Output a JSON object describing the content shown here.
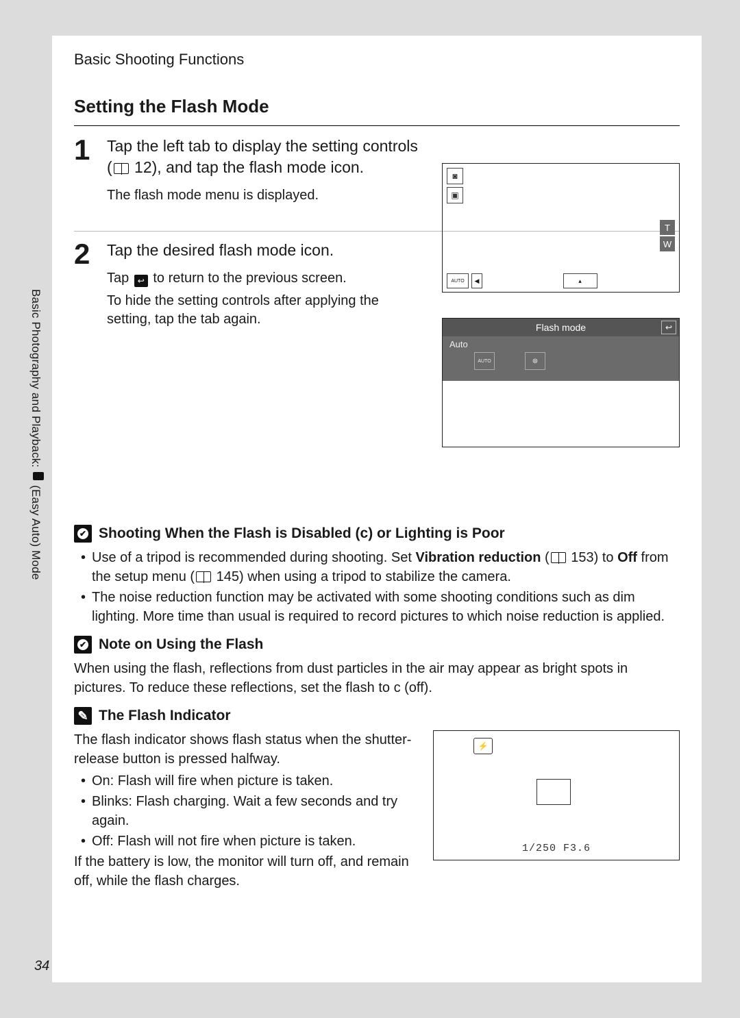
{
  "breadcrumb": "Basic Shooting Functions",
  "side_label_a": "Basic Photography and Playback: ",
  "side_label_b": " (Easy Auto) Mode",
  "page_number": "34",
  "heading": "Setting the Flash Mode",
  "step1": {
    "num": "1",
    "title_a": "Tap the left tab to display the setting controls (",
    "title_ref": " 12), and tap the flash mode icon.",
    "note": "The flash mode menu is displayed."
  },
  "step2": {
    "num": "2",
    "title": "Tap the desired flash mode icon.",
    "note_a": "Tap ",
    "note_b": " to return to the previous screen.",
    "note2": "To hide the setting controls after applying the setting, tap the tab again."
  },
  "screen1": {
    "zoom_t": "T",
    "zoom_w": "W",
    "auto_chip": "AUTO"
  },
  "screen2": {
    "title": "Flash mode",
    "selected_label": "Auto",
    "opt1": "AUTO",
    "opt2": "⊛"
  },
  "notes": {
    "n1_title": "Shooting When the Flash is Disabled (",
    "n1_title_b": ") or Lighting is Poor",
    "n1_off_sym": "c",
    "n1_b1_a": "Use of a tripod is recommended during shooting. Set ",
    "n1_b1_bold": "Vibration reduction",
    "n1_b1_b": " (",
    "n1_b1_ref": " 153) to ",
    "n1_b1_bold2": "Off",
    "n1_b1_c": " from the setup menu (",
    "n1_b1_ref2": " 145) when using a tripod to stabilize the camera.",
    "n1_b2": "The noise reduction function may be activated with some shooting conditions such as dim lighting. More time than usual is required to record pictures to which noise reduction is applied.",
    "n2_title": "Note on Using the Flash",
    "n2_p": "When using the flash, reflections from dust particles in the air may appear as bright spots in pictures. To reduce these reflections, set the flash to ",
    "n2_sym": "c",
    "n2_p2": " (off).",
    "n3_title": "The Flash Indicator",
    "n3_p": "The flash indicator shows flash status when the shutter-release button is pressed halfway.",
    "n3_b1": "On: Flash will fire when picture is taken.",
    "n3_b2": "Blinks: Flash charging. Wait a few seconds and try again.",
    "n3_b3": "Off: Flash will not fire when picture is taken.",
    "n3_p2": "If the battery is low, the monitor will turn off, and remain off, while the flash charges."
  },
  "screen3": {
    "readout": "1/250   F3.6"
  }
}
